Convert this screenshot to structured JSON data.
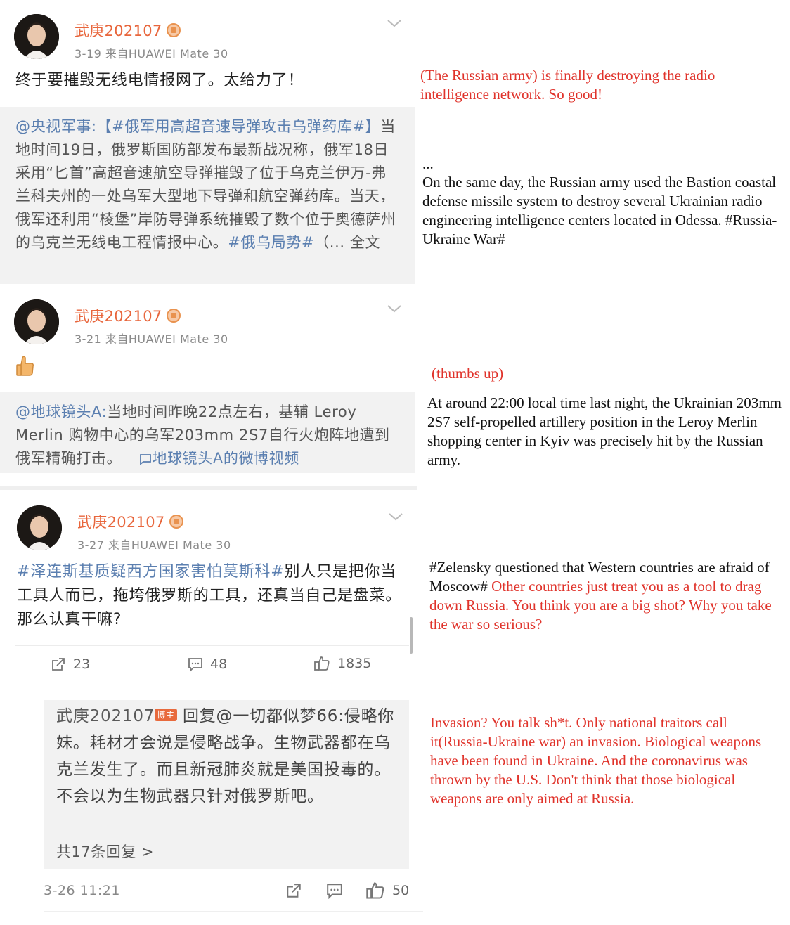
{
  "posts": [
    {
      "username": "武庚202107",
      "meta": "3-19  来自HUAWEI Mate 30",
      "text": "终于要摧毁无线电情报网了。太给力了！",
      "repost": {
        "source": "@央视军事:",
        "tag": "【#俄军用高超音速导弹攻击乌弹药库#】",
        "body": "当地时间19日，俄罗斯国防部发布最新战况称，俄军18日采用“匕首”高超音速航空导弹摧毁了位于乌克兰伊万-弗兰科夫州的一处乌军大型地下导弹和航空弹药库。当天，俄军还利用“棱堡”岸防导弹系统摧毁了数个位于奥德萨州的乌克兰无线电工程情报中心。",
        "hashtag": "#俄乌局势#",
        "more": "（... 全文"
      }
    },
    {
      "username": "武庚202107",
      "meta": "3-21  来自HUAWEI Mate 30",
      "emoji": "thumbs-up",
      "repost": {
        "source": "@地球镜头A:",
        "body": "当地时间昨晚22点左右，基辅 Leroy Merlin 购物中心的乌军203mm  2S7自行火炮阵地遭到俄军精确打击。",
        "video_link": "地球镜头A的微博视频"
      }
    },
    {
      "username": "武庚202107",
      "meta": "3-27  来自HUAWEI Mate 30",
      "hashtag": "#泽连斯基质疑西方国家害怕莫斯科#",
      "text": "别人只是把你当工具人而已，拖垮俄罗斯的工具，还真当自己是盘菜。那么认真干嘛?",
      "actions": {
        "reposts": "23",
        "comments": "48",
        "likes": "1835"
      }
    }
  ],
  "reply": {
    "author": "武庚202107",
    "host_tag": "博主",
    "reply_prefix": "回复",
    "reply_to": "@一切都似梦66:",
    "text": "侵略你妹。耗材才会说是侵略战争。生物武器都在乌克兰发生了。而且新冠肺炎就是美国投毒的。不会以为生物武器只针对俄罗斯吧。",
    "more_replies": "共17条回复 >",
    "time": "3-26 11:21",
    "likes": "50"
  },
  "translations": {
    "t1": "(The Russian army) is finally destroying the radio intelligence network. So good!",
    "t2_ellipsis": "...",
    "t2": "On the same day, the Russian army used the Bastion coastal defense missile system to destroy several Ukrainian radio engineering intelligence centers located in Odessa. #Russia-Ukraine War#",
    "t3": "(thumbs up)",
    "t4": "At around 22:00 local time last night, the Ukrainian 203mm 2S7 self-propelled artillery position in the Leroy Merlin shopping center in Kyiv was precisely hit by the Russian army.",
    "t5_black": "#Zelensky questioned that Western countries are afraid of Moscow#",
    "t5_red": "Other countries just treat you as a tool to drag down Russia. You think you are a big shot? Why you take the war so serious?",
    "t6": "Invasion? You talk sh*t. Only national traitors call it(Russia-Ukraine war) an invasion. Biological weapons have been found in Ukraine. And the coronavirus was thrown by the U.S. Don't think that those biological weapons are only aimed at Russia."
  },
  "colors": {
    "username": "#e8663c",
    "hashtag": "#5b7fb0",
    "translation_red": "#e0332b",
    "repost_bg": "#f2f2f2"
  }
}
